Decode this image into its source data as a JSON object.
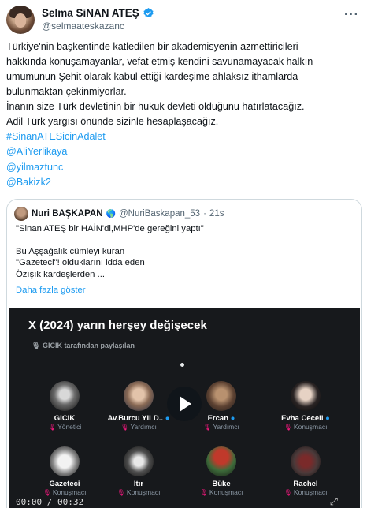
{
  "author": {
    "name": "Selma SiNAN ATEŞ",
    "handle": "@selmaateskazanc"
  },
  "more_icon": "more-dots-icon",
  "tweet": {
    "text": "Türkiye'nin başkentinde katledilen bir akademisyenin azmettiricileri\nhakkında konuşamayanlar, vefat etmiş kendini savunamayacak halkın\numumunun Şehit olarak kabul ettiği kardeşime ahlaksız ithamlarda\nbulunmaktan çekinmiyorlar.\nİnanın size Türk devletinin bir hukuk devleti olduğunu hatırlatacağız.\nAdil Türk yargısı önünde sizinle hesaplaşacağız.",
    "links": [
      "#SinanATESicinAdalet",
      "@AliYerlikaya",
      "@yilmaztunc",
      "@Bakizk2"
    ]
  },
  "quote": {
    "name": "Nuri BAŞKAPAN",
    "handle": "@NuriBaskapan_53",
    "time": "21s",
    "line1": "\"Sinan ATEŞ bir HAİN'di,MHP'de gereğini yaptı\"",
    "lines": [
      "Bu Aşşağalık cümleyi kuran",
      "\"Gazeteci\"! olduklarını idda eden",
      "Özışık kardeşlerden ..."
    ],
    "show_more": "Daha fazla göster"
  },
  "media": {
    "title": "X (2024) yarın herşey değişecek",
    "shared_by": "GICIK tarafından paylaşılan",
    "time": "00:00 / 00:32",
    "speakers": [
      {
        "name": "GICIK",
        "role": "Yönetici",
        "verified": false
      },
      {
        "name": "Av.Burcu YILD..",
        "role": "Yardımcı",
        "verified": true
      },
      {
        "name": "Ercan",
        "role": "Yardımcı",
        "verified": true
      },
      {
        "name": "Evha Ceceli",
        "role": "Konuşmacı",
        "verified": true
      },
      {
        "name": "Gazeteci",
        "role": "Konuşmacı",
        "verified": false
      },
      {
        "name": "Itır",
        "role": "Konuşmacı",
        "verified": false
      },
      {
        "name": "Büke",
        "role": "Konuşmacı",
        "verified": false
      },
      {
        "name": "Rachel",
        "role": "Konuşmacı",
        "verified": false
      }
    ]
  },
  "colors": {
    "link": "#1d9bf0",
    "verified": "#1d9bf0",
    "mic": "#f91880",
    "media_bg": "#17191c"
  }
}
